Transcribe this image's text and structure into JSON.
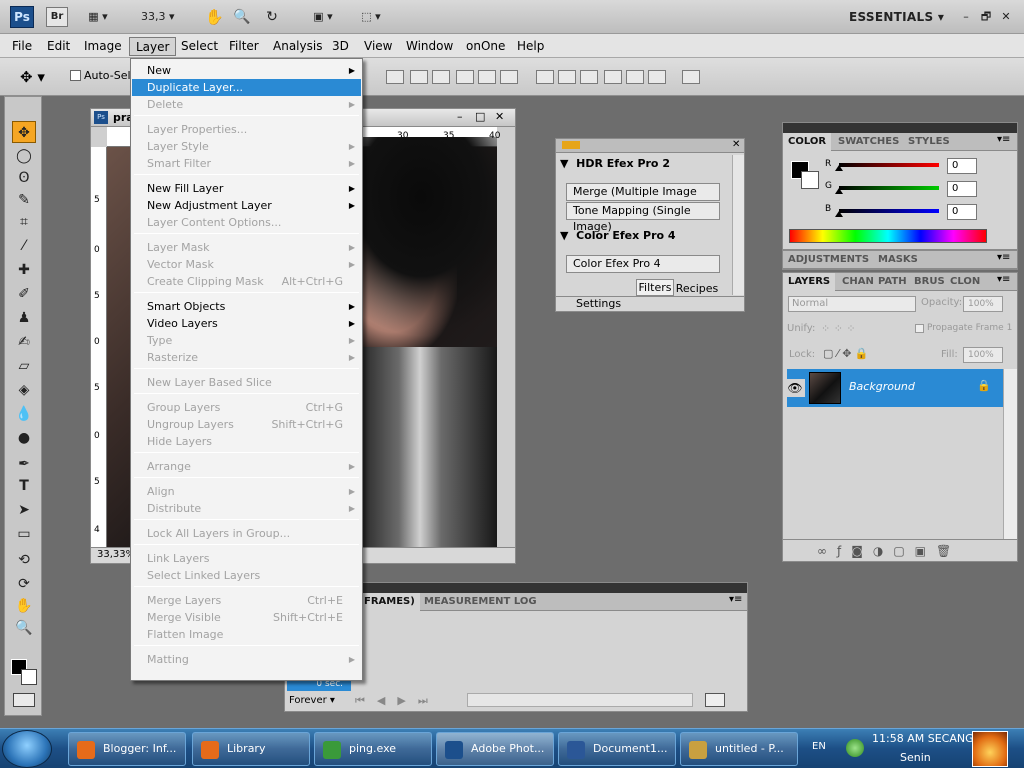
{
  "appbar": {
    "logo": "Ps",
    "bridge": "Br",
    "zoom": "33,3",
    "workspace": "ESSENTIALS",
    "minimize": "–",
    "restore": "🗗",
    "close": "✕"
  },
  "menubar": [
    "File",
    "Edit",
    "Image",
    "Layer",
    "Select",
    "Filter",
    "Analysis",
    "3D",
    "View",
    "Window",
    "onOne",
    "Help"
  ],
  "options": {
    "auto_select": "Auto-Selec"
  },
  "document": {
    "title": "pra",
    "zoom": "33,33%",
    "ruler_top": [
      "30",
      "35",
      "40"
    ],
    "ruler_left": [
      "5",
      "0",
      "5",
      "0",
      "5",
      "0",
      "5",
      "4"
    ]
  },
  "layer_menu": [
    {
      "label": "New",
      "arrow": true
    },
    {
      "label": "Duplicate Layer...",
      "highlight": true
    },
    {
      "label": "Delete",
      "arrow": true,
      "disabled": true
    },
    {
      "sep": true
    },
    {
      "label": "Layer Properties...",
      "disabled": true
    },
    {
      "label": "Layer Style",
      "arrow": true,
      "disabled": true
    },
    {
      "label": "Smart Filter",
      "arrow": true,
      "disabled": true
    },
    {
      "sep": true
    },
    {
      "label": "New Fill Layer",
      "arrow": true
    },
    {
      "label": "New Adjustment Layer",
      "arrow": true
    },
    {
      "label": "Layer Content Options...",
      "disabled": true
    },
    {
      "sep": true
    },
    {
      "label": "Layer Mask",
      "arrow": true,
      "disabled": true
    },
    {
      "label": "Vector Mask",
      "arrow": true,
      "disabled": true
    },
    {
      "label": "Create Clipping Mask",
      "shortcut": "Alt+Ctrl+G",
      "disabled": true
    },
    {
      "sep": true
    },
    {
      "label": "Smart Objects",
      "arrow": true
    },
    {
      "label": "Video Layers",
      "arrow": true
    },
    {
      "label": "Type",
      "arrow": true,
      "disabled": true
    },
    {
      "label": "Rasterize",
      "arrow": true,
      "disabled": true
    },
    {
      "sep": true
    },
    {
      "label": "New Layer Based Slice",
      "disabled": true
    },
    {
      "sep": true
    },
    {
      "label": "Group Layers",
      "shortcut": "Ctrl+G",
      "disabled": true
    },
    {
      "label": "Ungroup Layers",
      "shortcut": "Shift+Ctrl+G",
      "disabled": true
    },
    {
      "label": "Hide Layers",
      "disabled": true
    },
    {
      "sep": true
    },
    {
      "label": "Arrange",
      "arrow": true,
      "disabled": true
    },
    {
      "sep": true
    },
    {
      "label": "Align",
      "arrow": true,
      "disabled": true
    },
    {
      "label": "Distribute",
      "arrow": true,
      "disabled": true
    },
    {
      "sep": true
    },
    {
      "label": "Lock All Layers in Group...",
      "disabled": true
    },
    {
      "sep": true
    },
    {
      "label": "Link Layers",
      "disabled": true
    },
    {
      "label": "Select Linked Layers",
      "disabled": true
    },
    {
      "sep": true
    },
    {
      "label": "Merge Layers",
      "shortcut": "Ctrl+E",
      "disabled": true
    },
    {
      "label": "Merge Visible",
      "shortcut": "Shift+Ctrl+E",
      "disabled": true
    },
    {
      "label": "Flatten Image",
      "disabled": true
    },
    {
      "sep": true
    },
    {
      "label": "Matting",
      "arrow": true,
      "disabled": true
    }
  ],
  "plugin": {
    "hdr_title": "HDR Efex Pro 2",
    "hdr_btn1": "Merge (Multiple Image Series)",
    "hdr_btn2": "Tone Mapping (Single Image)",
    "color_title": "Color Efex Pro 4",
    "color_btn": "Color Efex Pro 4",
    "tab_filters": "Filters",
    "tab_recipes": "Recipes",
    "settings": "Settings"
  },
  "color_panel": {
    "tabs": [
      "COLOR",
      "SWATCHES",
      "STYLES"
    ],
    "r_label": "R",
    "g_label": "G",
    "b_label": "B",
    "r": "0",
    "g": "0",
    "b": "0",
    "r_level": 0,
    "g_level": 0,
    "b_level": 0
  },
  "adjust_tabs": [
    "ADJUSTMENTS",
    "MASKS"
  ],
  "layers_panel": {
    "tabs": [
      "LAYERS",
      "CHAN",
      "PATH",
      "BRUS",
      "CLON"
    ],
    "blend": "Normal",
    "opacity_label": "Opacity:",
    "opacity": "100%",
    "unify_label": "Unify:",
    "propagate": "Propagate Frame 1",
    "lock_label": "Lock:",
    "fill_label": "Fill:",
    "fill": "100%",
    "layer_name": "Background"
  },
  "timeline": {
    "tab_frames": "FRAMES)",
    "tab_measure": "MEASUREMENT LOG",
    "frame_time": "0 sec.",
    "loop": "Forever"
  },
  "taskbar": {
    "items": [
      {
        "label": "Blogger: Inf...",
        "color": "#e66b1a"
      },
      {
        "label": "Library",
        "color": "#e66b1a"
      },
      {
        "label": "ping.exe",
        "color": "#3a9a3a"
      },
      {
        "label": "Adobe Phot...",
        "color": "#1c4f8c",
        "active": true
      },
      {
        "label": "Document1...",
        "color": "#2b5797"
      },
      {
        "label": "untitled - P...",
        "color": "#c8a040"
      }
    ],
    "lang": "EN",
    "time": "11:58 AM SECANG",
    "day": "Senin"
  }
}
